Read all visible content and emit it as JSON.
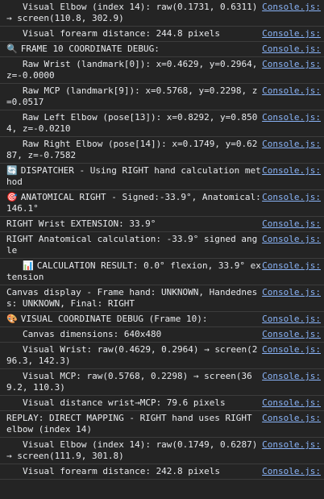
{
  "source_label": "Console.js:",
  "rows": [
    {
      "icon": "",
      "indent": true,
      "text": "Visual Elbow (index 14): raw(0.1731, 0.6311) → screen(110.8, 302.9)"
    },
    {
      "icon": "",
      "indent": true,
      "text": "Visual forearm distance: 244.8 pixels"
    },
    {
      "icon": "🔍",
      "indent": false,
      "text": "FRAME 10 COORDINATE DEBUG:"
    },
    {
      "icon": "",
      "indent": true,
      "text": "Raw Wrist (landmark[0]): x=0.4629, y=0.2964, z=-0.0000"
    },
    {
      "icon": "",
      "indent": true,
      "text": "Raw MCP (landmark[9]): x=0.5768, y=0.2298, z=0.0517"
    },
    {
      "icon": "",
      "indent": true,
      "text": "Raw Left Elbow (pose[13]): x=0.8292, y=0.8504, z=-0.0210"
    },
    {
      "icon": "",
      "indent": true,
      "text": "Raw Right Elbow (pose[14]): x=0.1749, y=0.6287, z=-0.7582"
    },
    {
      "icon": "🔄",
      "indent": false,
      "text": "DISPATCHER - Using RIGHT hand calculation method"
    },
    {
      "icon": "🎯",
      "indent": false,
      "text": "ANATOMICAL RIGHT - Signed:-33.9°, Anatomical:146.1°"
    },
    {
      "icon": "",
      "indent": false,
      "text": "RIGHT Wrist EXTENSION: 33.9°"
    },
    {
      "icon": "",
      "indent": false,
      "text": "RIGHT Anatomical calculation: -33.9° signed angle"
    },
    {
      "icon": "📊",
      "indent": true,
      "text": "CALCULATION RESULT: 0.0° flexion, 33.9° extension"
    },
    {
      "icon": "",
      "indent": false,
      "text": "Canvas display - Frame hand: UNKNOWN, Handedness: UNKNOWN, Final: RIGHT"
    },
    {
      "icon": "🎨",
      "indent": false,
      "text": "VISUAL COORDINATE DEBUG (Frame 10):"
    },
    {
      "icon": "",
      "indent": true,
      "text": "Canvas dimensions: 640x480"
    },
    {
      "icon": "",
      "indent": true,
      "text": "Visual Wrist: raw(0.4629, 0.2964) → screen(296.3, 142.3)"
    },
    {
      "icon": "",
      "indent": true,
      "text": "Visual MCP: raw(0.5768, 0.2298) → screen(369.2, 110.3)"
    },
    {
      "icon": "",
      "indent": true,
      "text": "Visual distance wrist→MCP: 79.6 pixels"
    },
    {
      "icon": "",
      "indent": false,
      "text": "REPLAY: DIRECT MAPPING - RIGHT hand uses RIGHT elbow (index 14)"
    },
    {
      "icon": "",
      "indent": true,
      "text": "Visual Elbow (index 14): raw(0.1749, 0.6287) → screen(111.9, 301.8)"
    },
    {
      "icon": "",
      "indent": true,
      "text": "Visual forearm distance: 242.8 pixels"
    }
  ]
}
